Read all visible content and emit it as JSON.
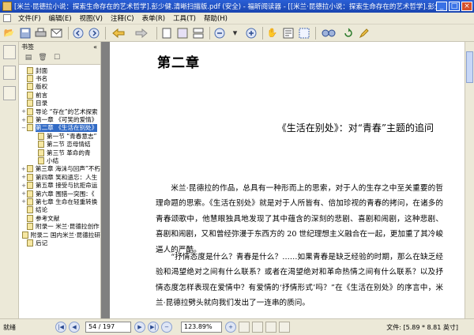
{
  "window": {
    "title": "[米兰·昆德拉小说：探索生命存在的艺术哲学].彭少健.清晰扫描版.pdf (安全) - 福昕阅读器 - [[米兰·昆德拉小说：探索生命存在的艺术哲学].彭少健",
    "minimize": "_",
    "maximize": "□",
    "close": "×"
  },
  "menu": [
    "文件(F)",
    "编辑(E)",
    "视图(V)",
    "注释(C)",
    "表单(R)",
    "工具(T)",
    "帮助(H)"
  ],
  "toolbar": {
    "icons": [
      "open-icon",
      "save-icon",
      "print-icon",
      "email-icon",
      "first-page-icon",
      "last-page-icon",
      "back-icon",
      "forward-icon",
      "single-page-icon",
      "facing-page-icon",
      "continuous-icon",
      "zoom-out-icon",
      "zoom-in-icon",
      "hand-tool-icon",
      "select-text-icon",
      "snapshot-icon",
      "find-icon",
      "rotate-icon",
      "annotate-icon"
    ]
  },
  "sidebar": {
    "title": "书签",
    "collapse": "«",
    "items": [
      {
        "label": "封面",
        "level": 0,
        "expander": ""
      },
      {
        "label": "书名",
        "level": 0,
        "expander": ""
      },
      {
        "label": "版权",
        "level": 0,
        "expander": ""
      },
      {
        "label": "前言",
        "level": 0,
        "expander": ""
      },
      {
        "label": "目录",
        "level": 0,
        "expander": ""
      },
      {
        "label": "导论 “存在”的艺术探索",
        "level": 0,
        "expander": "+"
      },
      {
        "label": "第一章 《可笑的爱情》",
        "level": 0,
        "expander": "+"
      },
      {
        "label": "第二章 《生活在别处》",
        "level": 0,
        "expander": "−",
        "selected": true
      },
      {
        "label": "第一节 “青春意志”",
        "level": 1,
        "expander": ""
      },
      {
        "label": "第二节 恋母情结",
        "level": 1,
        "expander": ""
      },
      {
        "label": "第三节 革命的青",
        "level": 1,
        "expander": ""
      },
      {
        "label": "小结",
        "level": 1,
        "expander": ""
      },
      {
        "label": "第三章 海沫与回声”不朽",
        "level": 0,
        "expander": "+"
      },
      {
        "label": "第四章 笑和遗忘：人生",
        "level": 0,
        "expander": "+"
      },
      {
        "label": "第五章 接受与抗拒命运",
        "level": 0,
        "expander": "+"
      },
      {
        "label": "第六章 围猎一突围：《",
        "level": 0,
        "expander": "+"
      },
      {
        "label": "第七章 生命在轻重转换",
        "level": 0,
        "expander": "+"
      },
      {
        "label": "结论",
        "level": 0,
        "expander": ""
      },
      {
        "label": "参考文献",
        "level": 0,
        "expander": ""
      },
      {
        "label": "附录一 米兰·昆德拉创作",
        "level": 0,
        "expander": ""
      },
      {
        "label": "附录二 国内米兰·昆德拉研",
        "level": 0,
        "expander": ""
      },
      {
        "label": "后记",
        "level": 0,
        "expander": ""
      }
    ]
  },
  "document": {
    "chapter": "第二章",
    "section": "《生活在别处》：对“青春”主题的追问",
    "para1": "米兰·昆德拉的作品，总具有一种形而上的思索，对于人的生存之中至关重要的哲理命题的思索。《生活在别处》就是对于人所皆有、倍加珍视的青春的拷问，在诸多的青春颂歌中，他慧眼独具地发现了其中蕴含的深刻的悲剧、喜剧和闹剧，这种悲剧、喜剧和闹剧，又和曾经弥漫于东西方的 20 世纪理想主义融合在一起，更加重了其冷峻逼人的严酷。",
    "para2": "“抒情态度是什么？青春是什么？……如果青春是缺乏经验的时期，那么在缺乏经验和渴望绝对之间有什么联系？或者在渴望绝对和革命热情之间有什么联系？以及抒情态度怎样表现在爱情中？有爱情的‘抒情形式’吗？”在《生活在别处》的序言中，米兰·昆德拉劈头就向我们发出了一连串的质问。"
  },
  "status": {
    "ready": "就绪",
    "page_display": "54 / 197",
    "zoom": "123.89%",
    "doc_size": "文件: [5.89 * 8.81 英寸]"
  }
}
